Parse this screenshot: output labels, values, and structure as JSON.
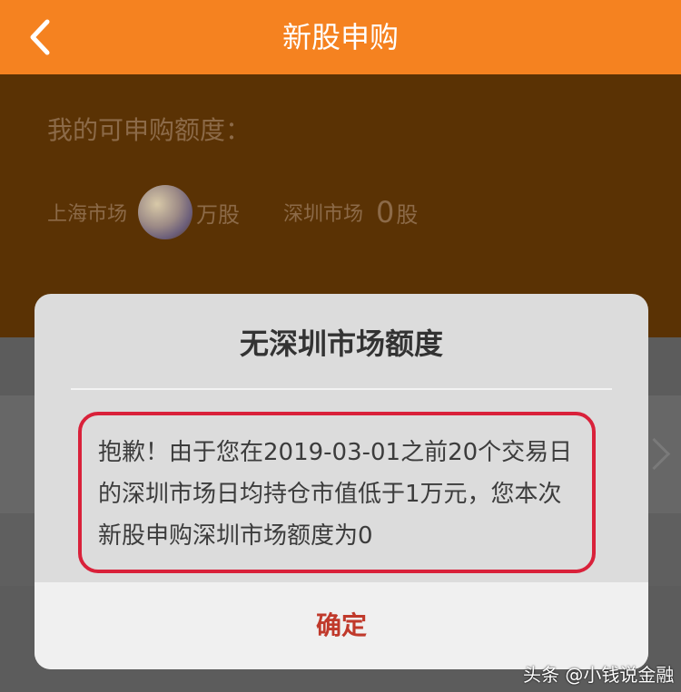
{
  "header": {
    "title": "新股申购",
    "back_icon": "chevron-left-icon"
  },
  "quota": {
    "title": "我的可申购额度：",
    "shanghai_label": "上海市场",
    "shanghai_unit": "万股",
    "shenzhen_label": "深圳市场",
    "shenzhen_value": "0",
    "shenzhen_unit": "股"
  },
  "dialog": {
    "title": "无深圳市场额度",
    "message": "抱歉！由于您在2019-03-01之前20个交易日的深圳市场日均持仓市值低于1万元，您本次新股申购深圳市场额度为0",
    "confirm_label": "确定"
  },
  "watermark": "头条 @小钱说金融",
  "colors": {
    "header_bg": "#f58220",
    "panel_bg": "#5a3204",
    "highlight_border": "#d9213a",
    "confirm_text": "#c0392b"
  }
}
